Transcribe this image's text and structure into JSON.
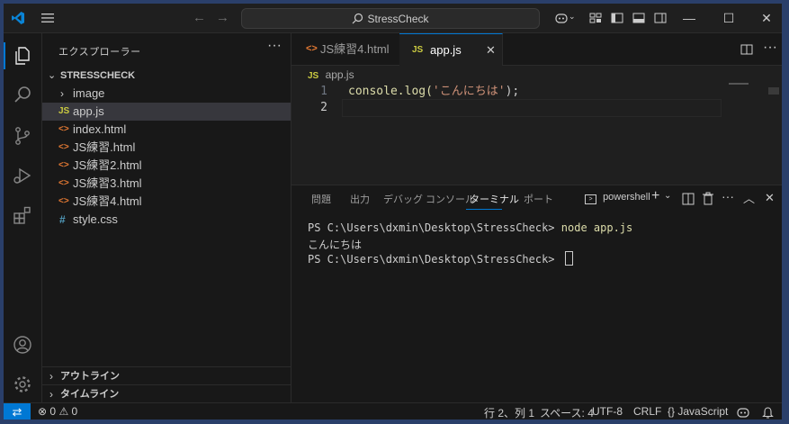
{
  "titlebar": {
    "search_text": "StressCheck"
  },
  "sidebar": {
    "title": "エクスプローラー",
    "more": "···",
    "folder_name": "STRESSCHECK",
    "items": [
      {
        "label": "image",
        "type": "folder"
      },
      {
        "label": "app.js",
        "type": "js"
      },
      {
        "label": "index.html",
        "type": "html"
      },
      {
        "label": "JS練習.html",
        "type": "html"
      },
      {
        "label": "JS練習2.html",
        "type": "html"
      },
      {
        "label": "JS練習3.html",
        "type": "html"
      },
      {
        "label": "JS練習4.html",
        "type": "html"
      },
      {
        "label": "style.css",
        "type": "css"
      }
    ],
    "outline_label": "アウトライン",
    "timeline_label": "タイムライン"
  },
  "badges": {
    "js": "JS",
    "html": "<>",
    "css": "#"
  },
  "editor": {
    "tabs": [
      {
        "label": "JS練習4.html",
        "type": "html",
        "active": false
      },
      {
        "label": "app.js",
        "type": "js",
        "active": true
      }
    ],
    "breadcrumb": "app.js",
    "lines": [
      {
        "num": "1",
        "text_plain": "console.log(",
        "text_string": "'こんにちは'",
        "text_end": ");"
      },
      {
        "num": "2",
        "text_plain": "",
        "text_string": "",
        "text_end": ""
      }
    ]
  },
  "panel": {
    "tabs": [
      "問題",
      "出力",
      "デバッグ コンソール",
      "ターミナル",
      "ポート"
    ],
    "active_tab": "ターミナル",
    "shell_label": "powershell",
    "terminal": {
      "line1_prompt": "PS C:\\Users\\dxmin\\Desktop\\StressCheck> ",
      "line1_cmd": "node app.js",
      "line2": "こんにちは",
      "line3_prompt": "PS C:\\Users\\dxmin\\Desktop\\StressCheck> "
    }
  },
  "statusbar": {
    "errors": "0",
    "warnings": "0",
    "position": "行 2、列 1",
    "spaces": "スペース: 4",
    "encoding": "UTF-8",
    "eol": "CRLF",
    "language": "JavaScript",
    "language_braces": "{}"
  },
  "colors": {
    "accent": "#0078d4",
    "js_badge": "#cbcb41",
    "html_badge": "#e37933",
    "css_badge": "#519aba",
    "string": "#ce9178",
    "function_call": "#dcdcaa"
  }
}
